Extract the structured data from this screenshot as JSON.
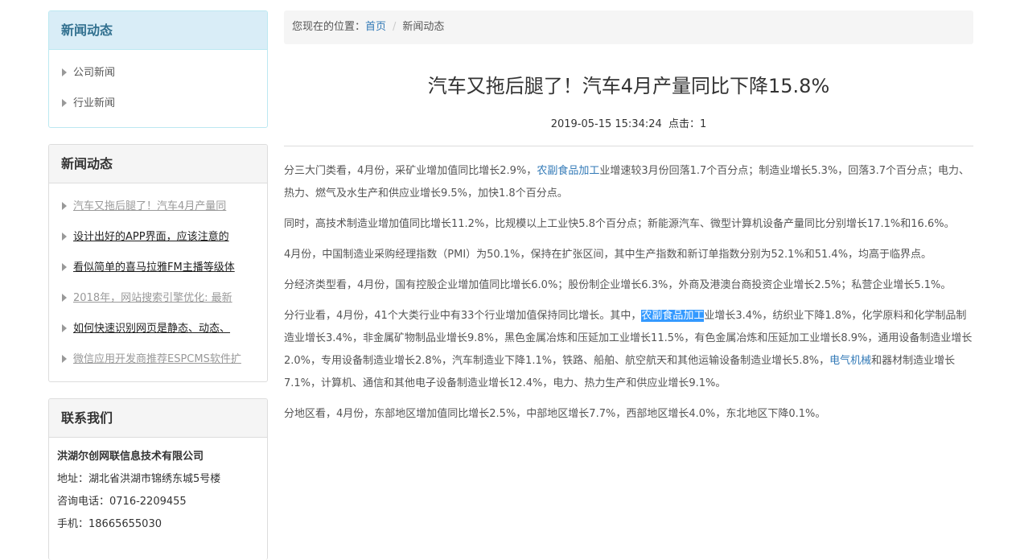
{
  "sidebar": {
    "panel1": {
      "title": "新闻动态",
      "items": [
        {
          "label": "公司新闻"
        },
        {
          "label": "行业新闻"
        }
      ]
    },
    "panel2": {
      "title": "新闻动态",
      "items": [
        {
          "label": "汽车又拖后腿了！汽车4月产量同"
        },
        {
          "label": "设计出好的APP界面，应该注意的"
        },
        {
          "label": "看似简单的喜马拉雅FM主播等级体"
        },
        {
          "label": "2018年，网站搜索引擎优化: 最新"
        },
        {
          "label": "如何快速识别网页是静态、动态、"
        },
        {
          "label": "微信应用开发商推荐ESPCMS软件扩"
        }
      ]
    },
    "contact": {
      "title": "联系我们",
      "company": "洪湖尔创网联信息技术有限公司",
      "address": "地址：湖北省洪湖市锦绣东城5号楼",
      "phone": "咨询电话：0716-2209455",
      "mobile": "手机：18665655030"
    }
  },
  "breadcrumb": {
    "prefix": "您现在的位置：",
    "home": "首页",
    "separator": "/",
    "current": "新闻动态"
  },
  "article": {
    "title": "汽车又拖后腿了！汽车4月产量同比下降15.8%",
    "meta": "2019-05-15 15:34:24  点击：1",
    "p1_a": "分三大门类看，4月份，采矿业增加值同比增长2.9%，",
    "p1_link": "农副食品加工",
    "p1_b": "业增速较3月份回落1.7个百分点；制造业增长5.3%，回落3.7个百分点；电力、热力、燃气及水生产和供应业增长9.5%，加快1.8个百分点。",
    "p2": "同时，高技术制造业增加值同比增长11.2%，比规模以上工业快5.8个百分点；新能源汽车、微型计算机设备产量同比分别增长17.1%和16.6%。",
    "p3": "4月份，中国制造业采购经理指数（PMI）为50.1%，保持在扩张区间，其中生产指数和新订单指数分别为52.1%和51.4%，均高于临界点。",
    "p4": "分经济类型看，4月份，国有控股企业增加值同比增长6.0%；股份制企业增长6.3%，外商及港澳台商投资企业增长2.5%；私营企业增长5.1%。",
    "p5_a": "分行业看，4月份，41个大类行业中有33个行业增加值保持同比增长。其中，",
    "p5_hl": "农副食品加工",
    "p5_b": "业增长3.4%，纺织业下降1.8%，化学原料和化学制品制造业增长3.4%，非金属矿物制品业增长9.8%，黑色金属冶炼和压延加工业增长11.5%，有色金属冶炼和压延加工业增长8.9%，通用设备制造业增长2.0%，专用设备制造业增长2.8%，汽车制造业下降1.1%，铁路、船舶、航空航天和其他运输设备制造业增长5.8%，",
    "p5_link": "电气机械",
    "p5_c": "和器材制造业增长7.1%，计算机、通信和其他电子设备制造业增长12.4%，电力、热力生产和供应业增长9.1%。",
    "p6": "分地区看，4月份，东部地区增加值同比增长2.5%，中部地区增长7.7%，西部地区增长4.0%，东北地区下降0.1%。"
  }
}
